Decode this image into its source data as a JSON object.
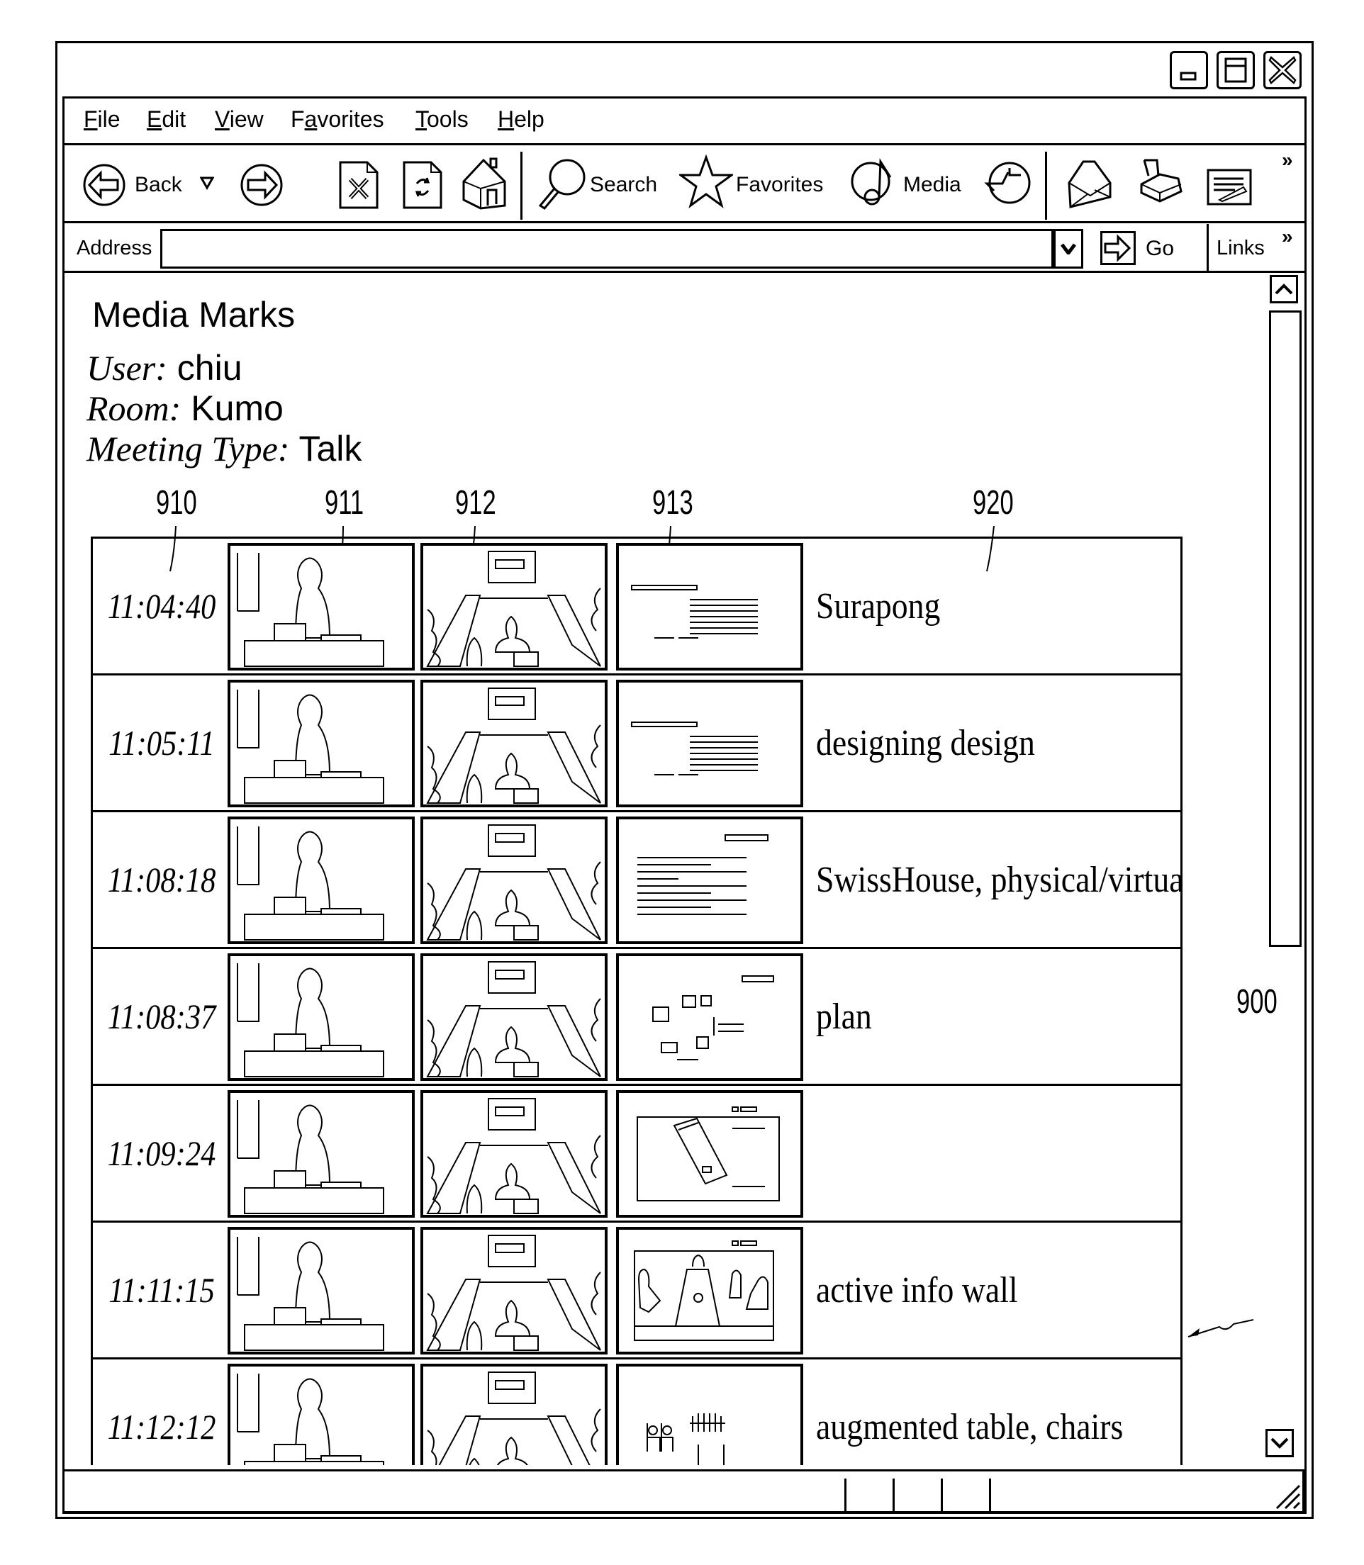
{
  "window": {
    "controls": [
      "minimize",
      "maximize",
      "close"
    ]
  },
  "menu": {
    "items": [
      {
        "label": "File",
        "mnemonic": "F",
        "rest": "ile"
      },
      {
        "label": "Edit",
        "mnemonic": "E",
        "rest": "dit"
      },
      {
        "label": "View",
        "mnemonic": "V",
        "rest": "iew"
      },
      {
        "label": "Favorites",
        "pre": "F",
        "mnemonic": "a",
        "rest": "vorites"
      },
      {
        "label": "Tools",
        "mnemonic": "T",
        "rest": "ools"
      },
      {
        "label": "Help",
        "mnemonic": "H",
        "rest": "elp"
      }
    ]
  },
  "toolbar": {
    "back_label": "Back",
    "search_label": "Search",
    "favorites_label": "Favorites",
    "media_label": "Media",
    "overflow": "»",
    "icons": [
      "back-icon",
      "back-dropdown-icon",
      "forward-icon",
      "stop-icon",
      "refresh-icon",
      "home-icon",
      "search-icon",
      "favorites-star-icon",
      "media-music-icon",
      "history-icon",
      "mail-icon",
      "print-icon",
      "edit-icon"
    ]
  },
  "address_bar": {
    "label": "Address",
    "value": "",
    "go_label": "Go",
    "links_label": "Links",
    "overflow": "»"
  },
  "page": {
    "title": "Media Marks",
    "user_key": "User:",
    "user_value": "chiu",
    "room_key": "Room:",
    "room_value": "Kumo",
    "meeting_key": "Meeting Type:",
    "meeting_value": "Talk"
  },
  "annotations": {
    "col_time": "910",
    "col_video1": "911",
    "col_video2": "912",
    "col_slide": "913",
    "col_label": "920",
    "figure": "900"
  },
  "marks": [
    {
      "time": "11:04:40",
      "label": "Surapong",
      "slide": "text"
    },
    {
      "time": "11:05:11",
      "label": "designing design",
      "slide": "text"
    },
    {
      "time": "11:08:18",
      "label": "SwissHouse, physical/virtual",
      "slide": "list"
    },
    {
      "time": "11:08:37",
      "label": "plan",
      "slide": "plan"
    },
    {
      "time": "11:09:24",
      "label": "",
      "slide": "table"
    },
    {
      "time": "11:11:15",
      "label": "active info wall",
      "slide": "meeting"
    },
    {
      "time": "11:12:12",
      "label": "augmented table, chairs",
      "slide": "chairs"
    }
  ]
}
